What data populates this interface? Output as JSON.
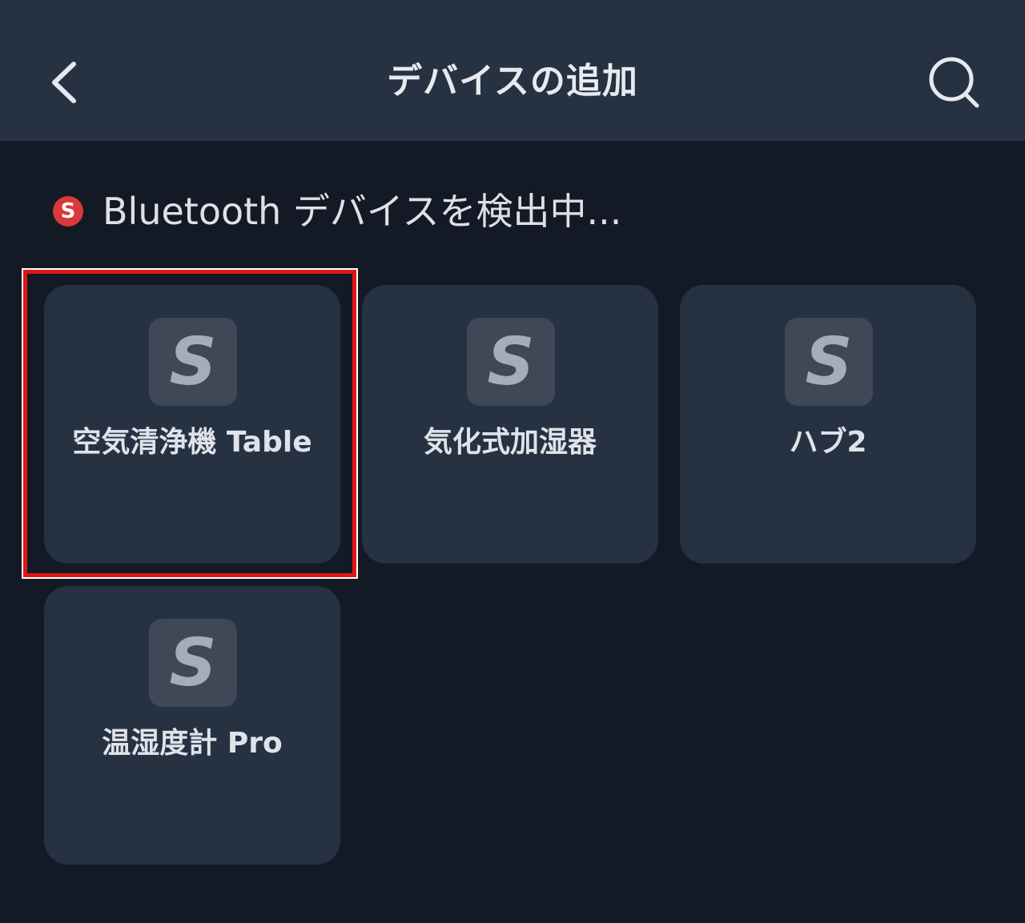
{
  "header": {
    "title": "デバイスの追加",
    "back_icon": "chevron-left-icon",
    "search_icon": "search-icon"
  },
  "scan": {
    "icon_letter": "S",
    "text": "Bluetooth デバイスを検出中..."
  },
  "devices": [
    {
      "logo_letter": "S",
      "name": "空気清浄機 Table",
      "highlighted": true
    },
    {
      "logo_letter": "S",
      "name": "気化式加湿器",
      "highlighted": false
    },
    {
      "logo_letter": "S",
      "name": "ハブ2",
      "highlighted": false
    },
    {
      "logo_letter": "S",
      "name": "温湿度計 Pro",
      "highlighted": false
    }
  ],
  "colors": {
    "background": "#131a25",
    "header": "#263142",
    "card": "#263142",
    "logo_tile": "#3e4856",
    "scan_icon": "#d83a3a",
    "highlight_border": "#e01616"
  }
}
